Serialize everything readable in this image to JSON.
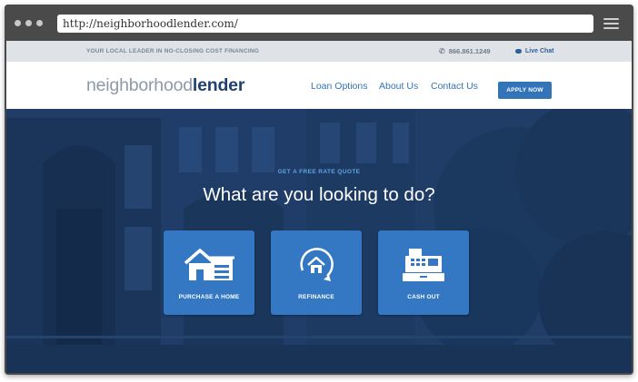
{
  "browser": {
    "url": "http://neighborhoodlender.com/"
  },
  "topbar": {
    "tagline": "YOUR LOCAL LEADER IN NO-CLOSING COST FINANCING",
    "phone": "866.861.1249",
    "live_chat": "Live Chat"
  },
  "header": {
    "logo_light": "neighborhood",
    "logo_bold": "lender",
    "nav": {
      "loan_options": "Loan Options",
      "about_us": "About Us",
      "contact_us": "Contact Us"
    },
    "apply_label": "APPLY NOW"
  },
  "hero": {
    "eyebrow": "GET A FREE RATE QUOTE",
    "headline": "What are you looking to do?",
    "cards": [
      {
        "label": "PURCHASE A HOME",
        "icon": "house-icon"
      },
      {
        "label": "REFINANCE",
        "icon": "refinance-icon"
      },
      {
        "label": "CASH OUT",
        "icon": "cash-register-icon"
      }
    ]
  },
  "colors": {
    "brand_blue": "#3373b8",
    "card_blue": "#3478c4",
    "logo_navy": "#1e416f",
    "hero_overlay": "#1d3c66"
  }
}
